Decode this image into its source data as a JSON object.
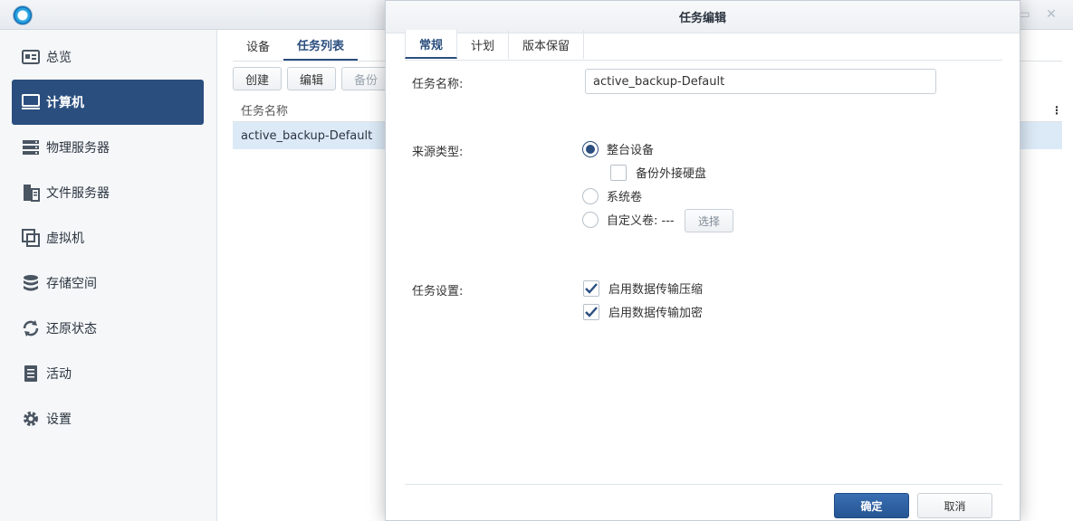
{
  "sidebar": {
    "items": [
      {
        "label": "总览",
        "icon": "overview-icon"
      },
      {
        "label": "计算机",
        "icon": "computer-icon",
        "active": true
      },
      {
        "label": "物理服务器",
        "icon": "server-icon"
      },
      {
        "label": "文件服务器",
        "icon": "file-server-icon"
      },
      {
        "label": "虚拟机",
        "icon": "virtual-machine-icon"
      },
      {
        "label": "存储空间",
        "icon": "storage-icon"
      },
      {
        "label": "还原状态",
        "icon": "restore-icon"
      },
      {
        "label": "活动",
        "icon": "activity-icon"
      },
      {
        "label": "设置",
        "icon": "gear-icon"
      }
    ]
  },
  "content": {
    "tabs": [
      "设备",
      "任务列表"
    ],
    "active_tab": "任务列表",
    "toolbar": {
      "create": "创建",
      "edit": "编辑",
      "backup": "备份"
    },
    "grid": {
      "column_header": "任务名称",
      "rows": [
        "active_backup-Default"
      ]
    }
  },
  "modal": {
    "title": "任务编辑",
    "tabs": [
      "常规",
      "计划",
      "版本保留"
    ],
    "active_tab": "常规",
    "task_name_label": "任务名称:",
    "task_name_value": "active_backup-Default",
    "source_type_label": "来源类型:",
    "source_options": {
      "whole_device": "整台设备",
      "backup_external": "备份外接硬盘",
      "system_volume": "系统卷",
      "custom_volume": "自定义卷: ---"
    },
    "select_button": "选择",
    "task_settings_label": "任务设置:",
    "settings_options": {
      "compression": "启用数据传输压缩",
      "encryption": "启用数据传输加密"
    },
    "ok_button": "确定",
    "cancel_button": "取消"
  },
  "colors": {
    "accent": "#2a4e7e",
    "selected_row": "#dceaf7"
  }
}
